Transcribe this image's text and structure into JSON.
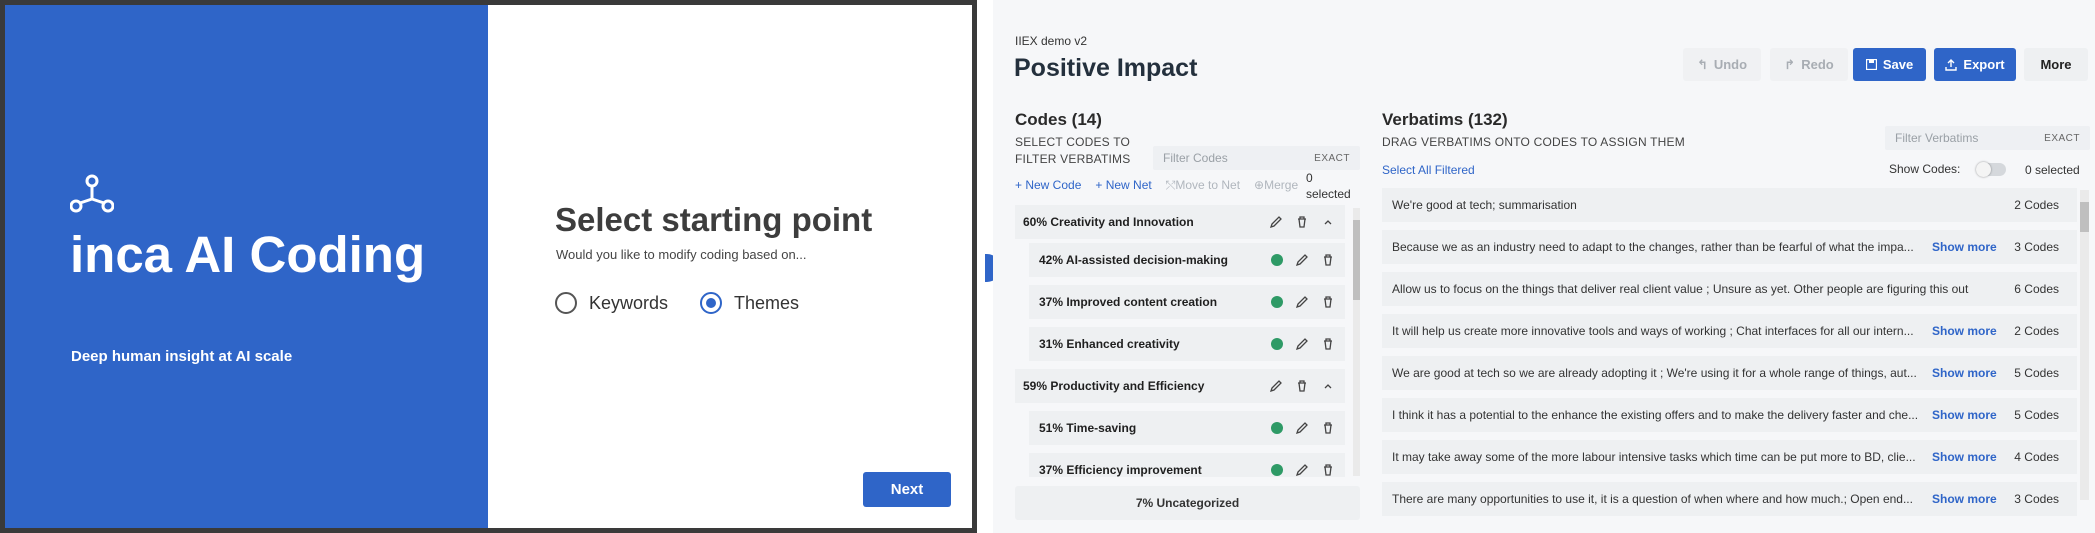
{
  "dialog": {
    "brand_title": "inca AI Coding",
    "brand_tagline": "Deep human insight at AI scale",
    "heading": "Select starting point",
    "subheading": "Would you like to modify coding based on...",
    "options": [
      {
        "label": "Keywords",
        "checked": false
      },
      {
        "label": "Themes",
        "checked": true
      }
    ],
    "next_label": "Next"
  },
  "header": {
    "project": "IIEX demo v2",
    "title": "Positive Impact",
    "undo": "Undo",
    "redo": "Redo",
    "save": "Save",
    "export": "Export",
    "more": "More"
  },
  "codes": {
    "title": "Codes (14)",
    "subtitle_line1": "SELECT CODES TO",
    "subtitle_line2": "FILTER VERBATIMS",
    "filter_placeholder": "Filter Codes",
    "exact": "EXACT",
    "new_code": "+ New Code",
    "new_net": "+ New Net",
    "move_to_net": "Move to Net",
    "merge": "Merge",
    "selected_num": "0",
    "selected_word": "selected",
    "items": [
      {
        "label": "60% Creativity and Innovation",
        "kind": "parent"
      },
      {
        "label": "42% AI-assisted decision-making",
        "kind": "child"
      },
      {
        "label": "37% Improved content creation",
        "kind": "child"
      },
      {
        "label": "31% Enhanced creativity",
        "kind": "child"
      },
      {
        "label": "59% Productivity and Efficiency",
        "kind": "parent"
      },
      {
        "label": "51% Time-saving",
        "kind": "child"
      },
      {
        "label": "37% Efficiency improvement",
        "kind": "child"
      }
    ],
    "uncategorized": "7% Uncategorized"
  },
  "verbatims": {
    "title": "Verbatims (132)",
    "subtitle": "DRAG VERBATIMS ONTO CODES TO ASSIGN THEM",
    "filter_placeholder": "Filter Verbatims",
    "exact": "EXACT",
    "select_all": "Select All Filtered",
    "show_codes": "Show Codes:",
    "selected": "0 selected",
    "show_more": "Show more",
    "rows": [
      {
        "text": "We're good at tech; summarisation",
        "codes": "2 Codes",
        "more": false
      },
      {
        "text": "Because we as an industry need to adapt to the changes, rather than be fearful of what the impa...",
        "codes": "3 Codes",
        "more": true
      },
      {
        "text": "Allow us to focus on the things that deliver real client value ; Unsure as yet. Other people are figuring this out",
        "codes": "6 Codes",
        "more": false
      },
      {
        "text": "It will help us create more innovative tools and ways of working ; Chat interfaces for all our intern...",
        "codes": "2 Codes",
        "more": true
      },
      {
        "text": "We are good at tech so we are already adopting it ; We're using it for a whole range of things, aut...",
        "codes": "5 Codes",
        "more": true
      },
      {
        "text": "I think it has a potential to the enhance the existing offers and to make the delivery faster and che...",
        "codes": "5 Codes",
        "more": true
      },
      {
        "text": "It may take away some of the more labour intensive tasks which time can be put more to BD, clie...",
        "codes": "4 Codes",
        "more": true
      },
      {
        "text": "There are many opportunities to use it, it is a question of when where and how much.; Open end...",
        "codes": "3 Codes",
        "more": true
      }
    ]
  },
  "colors": {
    "brand": "#2f65c8",
    "code_dot": "#2e9a66"
  }
}
